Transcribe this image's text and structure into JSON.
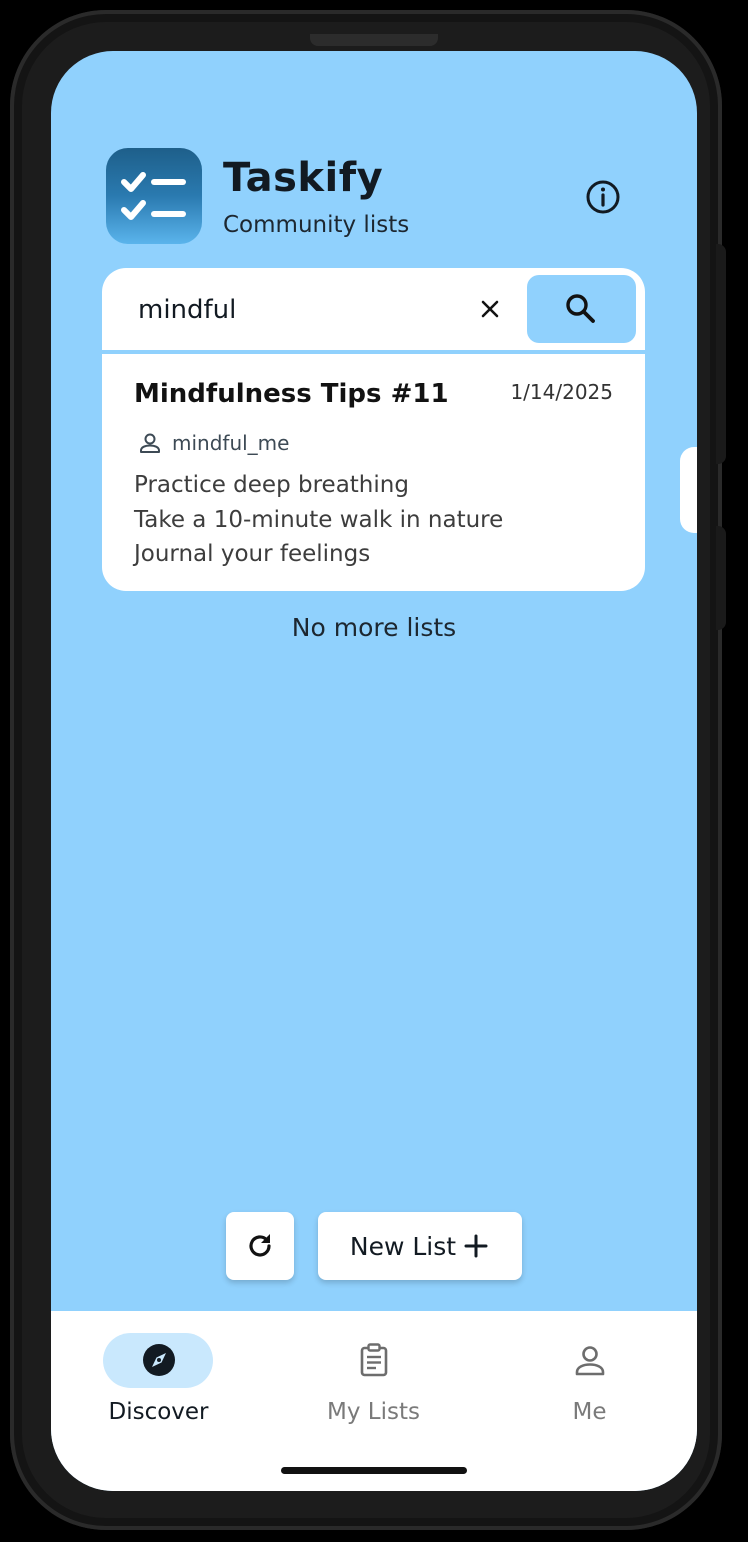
{
  "app": {
    "title": "Taskify",
    "subtitle": "Community lists"
  },
  "search": {
    "value": "mindful",
    "placeholder": ""
  },
  "results": [
    {
      "title": "Mindfulness Tips #11",
      "date": "1/14/2025",
      "author": "mindful_me",
      "lines": [
        "Practice deep breathing",
        "Take a 10-minute walk in nature",
        "Journal your feelings"
      ]
    }
  ],
  "status": {
    "end_of_list": "No more lists"
  },
  "actions": {
    "new_list_label": "New List"
  },
  "nav": {
    "items": [
      {
        "label": "Discover",
        "icon": "compass-icon",
        "active": true
      },
      {
        "label": "My Lists",
        "icon": "clipboard-icon",
        "active": false
      },
      {
        "label": "Me",
        "icon": "person-icon",
        "active": false
      }
    ]
  },
  "colors": {
    "background": "#90d1fd",
    "card": "#ffffff",
    "nav_active_pill": "#c9e8fd",
    "text_primary": "#121a22"
  }
}
